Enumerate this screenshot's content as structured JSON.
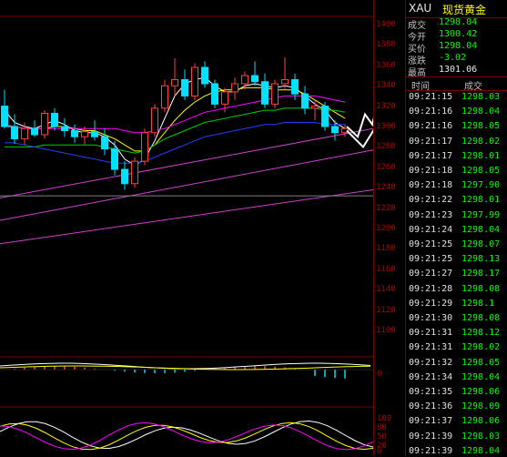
{
  "colors": {
    "up": "#ff4040",
    "down": "#00e0ff",
    "price": "#00ff00",
    "negative": "#00ff00",
    "axis_text": "#b40000",
    "ma1": "#ffffff",
    "ma2": "#ffff00",
    "ma3": "#ff00ff",
    "ma4": "#00cc00",
    "ma5": "#2040ff"
  },
  "axis": {
    "price_labels": [
      "1400",
      "1380",
      "1360",
      "1340",
      "1320",
      "1300",
      "1280",
      "1260",
      "1240",
      "1220",
      "1200",
      "1180",
      "1160",
      "1140",
      "1120",
      "1100"
    ],
    "macd_zero": "0",
    "kdj_labels": [
      "100",
      "80",
      "50",
      "20",
      "0"
    ]
  },
  "quote": {
    "symbol": "XAU",
    "name": "现货黄金",
    "rows": [
      {
        "label": "成交",
        "value": "1298.04",
        "color": "price"
      },
      {
        "label": "今开",
        "value": "1300.42",
        "color": "price"
      },
      {
        "label": "买价",
        "value": "1298.04",
        "color": "price"
      },
      {
        "label": "涨跌",
        "value": "-3.02",
        "color": "negative"
      },
      {
        "label": "最高",
        "value": "1301.06",
        "color": "white"
      }
    ]
  },
  "ticks": {
    "header_time": "时间",
    "header_price": "成交",
    "rows": [
      {
        "time": "09:21:15",
        "price": "1298.03"
      },
      {
        "time": "09:21:16",
        "price": "1298.04"
      },
      {
        "time": "09:21:16",
        "price": "1298.05"
      },
      {
        "time": "09:21:17",
        "price": "1298.02"
      },
      {
        "time": "09:21:17",
        "price": "1298.01"
      },
      {
        "time": "09:21:18",
        "price": "1298.05"
      },
      {
        "time": "09:21:18",
        "price": "1297.90"
      },
      {
        "time": "09:21:22",
        "price": "1298.01"
      },
      {
        "time": "09:21:23",
        "price": "1297.99"
      },
      {
        "time": "09:21:24",
        "price": "1298.04"
      },
      {
        "time": "09:21:25",
        "price": "1298.07"
      },
      {
        "time": "09:21:25",
        "price": "1298.13"
      },
      {
        "time": "09:21:27",
        "price": "1298.17"
      },
      {
        "time": "09:21:28",
        "price": "1298.08"
      },
      {
        "time": "09:21:29",
        "price": "1298.1"
      },
      {
        "time": "09:21:30",
        "price": "1298.08"
      },
      {
        "time": "09:21:31",
        "price": "1298.12"
      },
      {
        "time": "09:21:31",
        "price": "1298.02"
      },
      {
        "time": "09:21:32",
        "price": "1298.05"
      },
      {
        "time": "09:21:34",
        "price": "1298.04"
      },
      {
        "time": "09:21:35",
        "price": "1298.06"
      },
      {
        "time": "09:21:36",
        "price": "1298.09"
      },
      {
        "time": "09:21:37",
        "price": "1298.06"
      },
      {
        "time": "09:21:39",
        "price": "1298.03"
      },
      {
        "time": "09:21:39",
        "price": "1298.04"
      }
    ]
  },
  "chart_data": {
    "type": "candlestick",
    "ylim": [
      1100,
      1410
    ],
    "candles": [
      [
        1320,
        1336,
        1298,
        1300
      ],
      [
        1300,
        1312,
        1283,
        1288
      ],
      [
        1288,
        1304,
        1282,
        1298
      ],
      [
        1298,
        1306,
        1290,
        1292
      ],
      [
        1292,
        1316,
        1288,
        1313
      ],
      [
        1313,
        1318,
        1296,
        1300
      ],
      [
        1300,
        1308,
        1290,
        1296
      ],
      [
        1296,
        1302,
        1284,
        1290
      ],
      [
        1290,
        1300,
        1282,
        1295
      ],
      [
        1295,
        1306,
        1286,
        1290
      ],
      [
        1290,
        1298,
        1272,
        1278
      ],
      [
        1278,
        1286,
        1252,
        1258
      ],
      [
        1258,
        1266,
        1238,
        1244
      ],
      [
        1244,
        1270,
        1240,
        1266
      ],
      [
        1266,
        1298,
        1262,
        1294
      ],
      [
        1294,
        1322,
        1290,
        1318
      ],
      [
        1318,
        1346,
        1314,
        1340
      ],
      [
        1340,
        1367,
        1330,
        1346
      ],
      [
        1346,
        1356,
        1326,
        1330
      ],
      [
        1330,
        1362,
        1326,
        1358
      ],
      [
        1358,
        1364,
        1338,
        1342
      ],
      [
        1342,
        1346,
        1318,
        1322
      ],
      [
        1322,
        1338,
        1314,
        1334
      ],
      [
        1334,
        1348,
        1326,
        1342
      ],
      [
        1342,
        1354,
        1336,
        1350
      ],
      [
        1350,
        1364,
        1340,
        1344
      ],
      [
        1344,
        1352,
        1318,
        1322
      ],
      [
        1322,
        1346,
        1318,
        1342
      ],
      [
        1342,
        1368,
        1336,
        1346
      ],
      [
        1346,
        1352,
        1326,
        1332
      ],
      [
        1332,
        1340,
        1312,
        1318
      ],
      [
        1318,
        1326,
        1306,
        1320
      ],
      [
        1320,
        1324,
        1296,
        1300
      ],
      [
        1300,
        1306,
        1286,
        1294
      ],
      [
        1294,
        1302,
        1290,
        1298
      ]
    ],
    "ma": [
      {
        "color": "ma1",
        "values": [
          1316,
          1304,
          1300,
          1298,
          1302,
          1306,
          1302,
          1296,
          1294,
          1294,
          1290,
          1282,
          1268,
          1262,
          1268,
          1286,
          1308,
          1330,
          1342,
          1346,
          1348,
          1340,
          1334,
          1334,
          1340,
          1342,
          1340,
          1338,
          1340,
          1338,
          1330,
          1322,
          1316,
          1304,
          1298
        ]
      },
      {
        "color": "ma2",
        "values": [
          1300,
          1300,
          1298,
          1298,
          1298,
          1300,
          1300,
          1298,
          1296,
          1296,
          1292,
          1288,
          1282,
          1276,
          1276,
          1282,
          1294,
          1306,
          1316,
          1324,
          1330,
          1334,
          1336,
          1336,
          1338,
          1338,
          1338,
          1336,
          1336,
          1336,
          1332,
          1326,
          1320,
          1314,
          1308
        ]
      },
      {
        "color": "ma3",
        "values": [
          1302,
          1300,
          1298,
          1298,
          1298,
          1298,
          1298,
          1298,
          1298,
          1298,
          1298,
          1298,
          1296,
          1294,
          1294,
          1296,
          1298,
          1302,
          1306,
          1310,
          1314,
          1316,
          1318,
          1320,
          1322,
          1324,
          1326,
          1328,
          1330,
          1330,
          1330,
          1330,
          1328,
          1326,
          1324
        ]
      },
      {
        "color": "ma4",
        "values": [
          1280,
          1280,
          1280,
          1280,
          1282,
          1282,
          1282,
          1282,
          1282,
          1282,
          1280,
          1278,
          1276,
          1274,
          1276,
          1282,
          1288,
          1292,
          1296,
          1300,
          1304,
          1306,
          1308,
          1310,
          1312,
          1314,
          1316,
          1316,
          1318,
          1318,
          1318,
          1318,
          1316,
          1316,
          1314
        ]
      },
      {
        "color": "ma5",
        "values": [
          1284,
          1284,
          1282,
          1280,
          1278,
          1276,
          1274,
          1272,
          1270,
          1268,
          1266,
          1264,
          1264,
          1264,
          1266,
          1270,
          1274,
          1278,
          1282,
          1286,
          1290,
          1292,
          1294,
          1296,
          1298,
          1300,
          1302,
          1302,
          1304,
          1304,
          1304,
          1304,
          1302,
          1302,
          1302
        ]
      }
    ]
  }
}
